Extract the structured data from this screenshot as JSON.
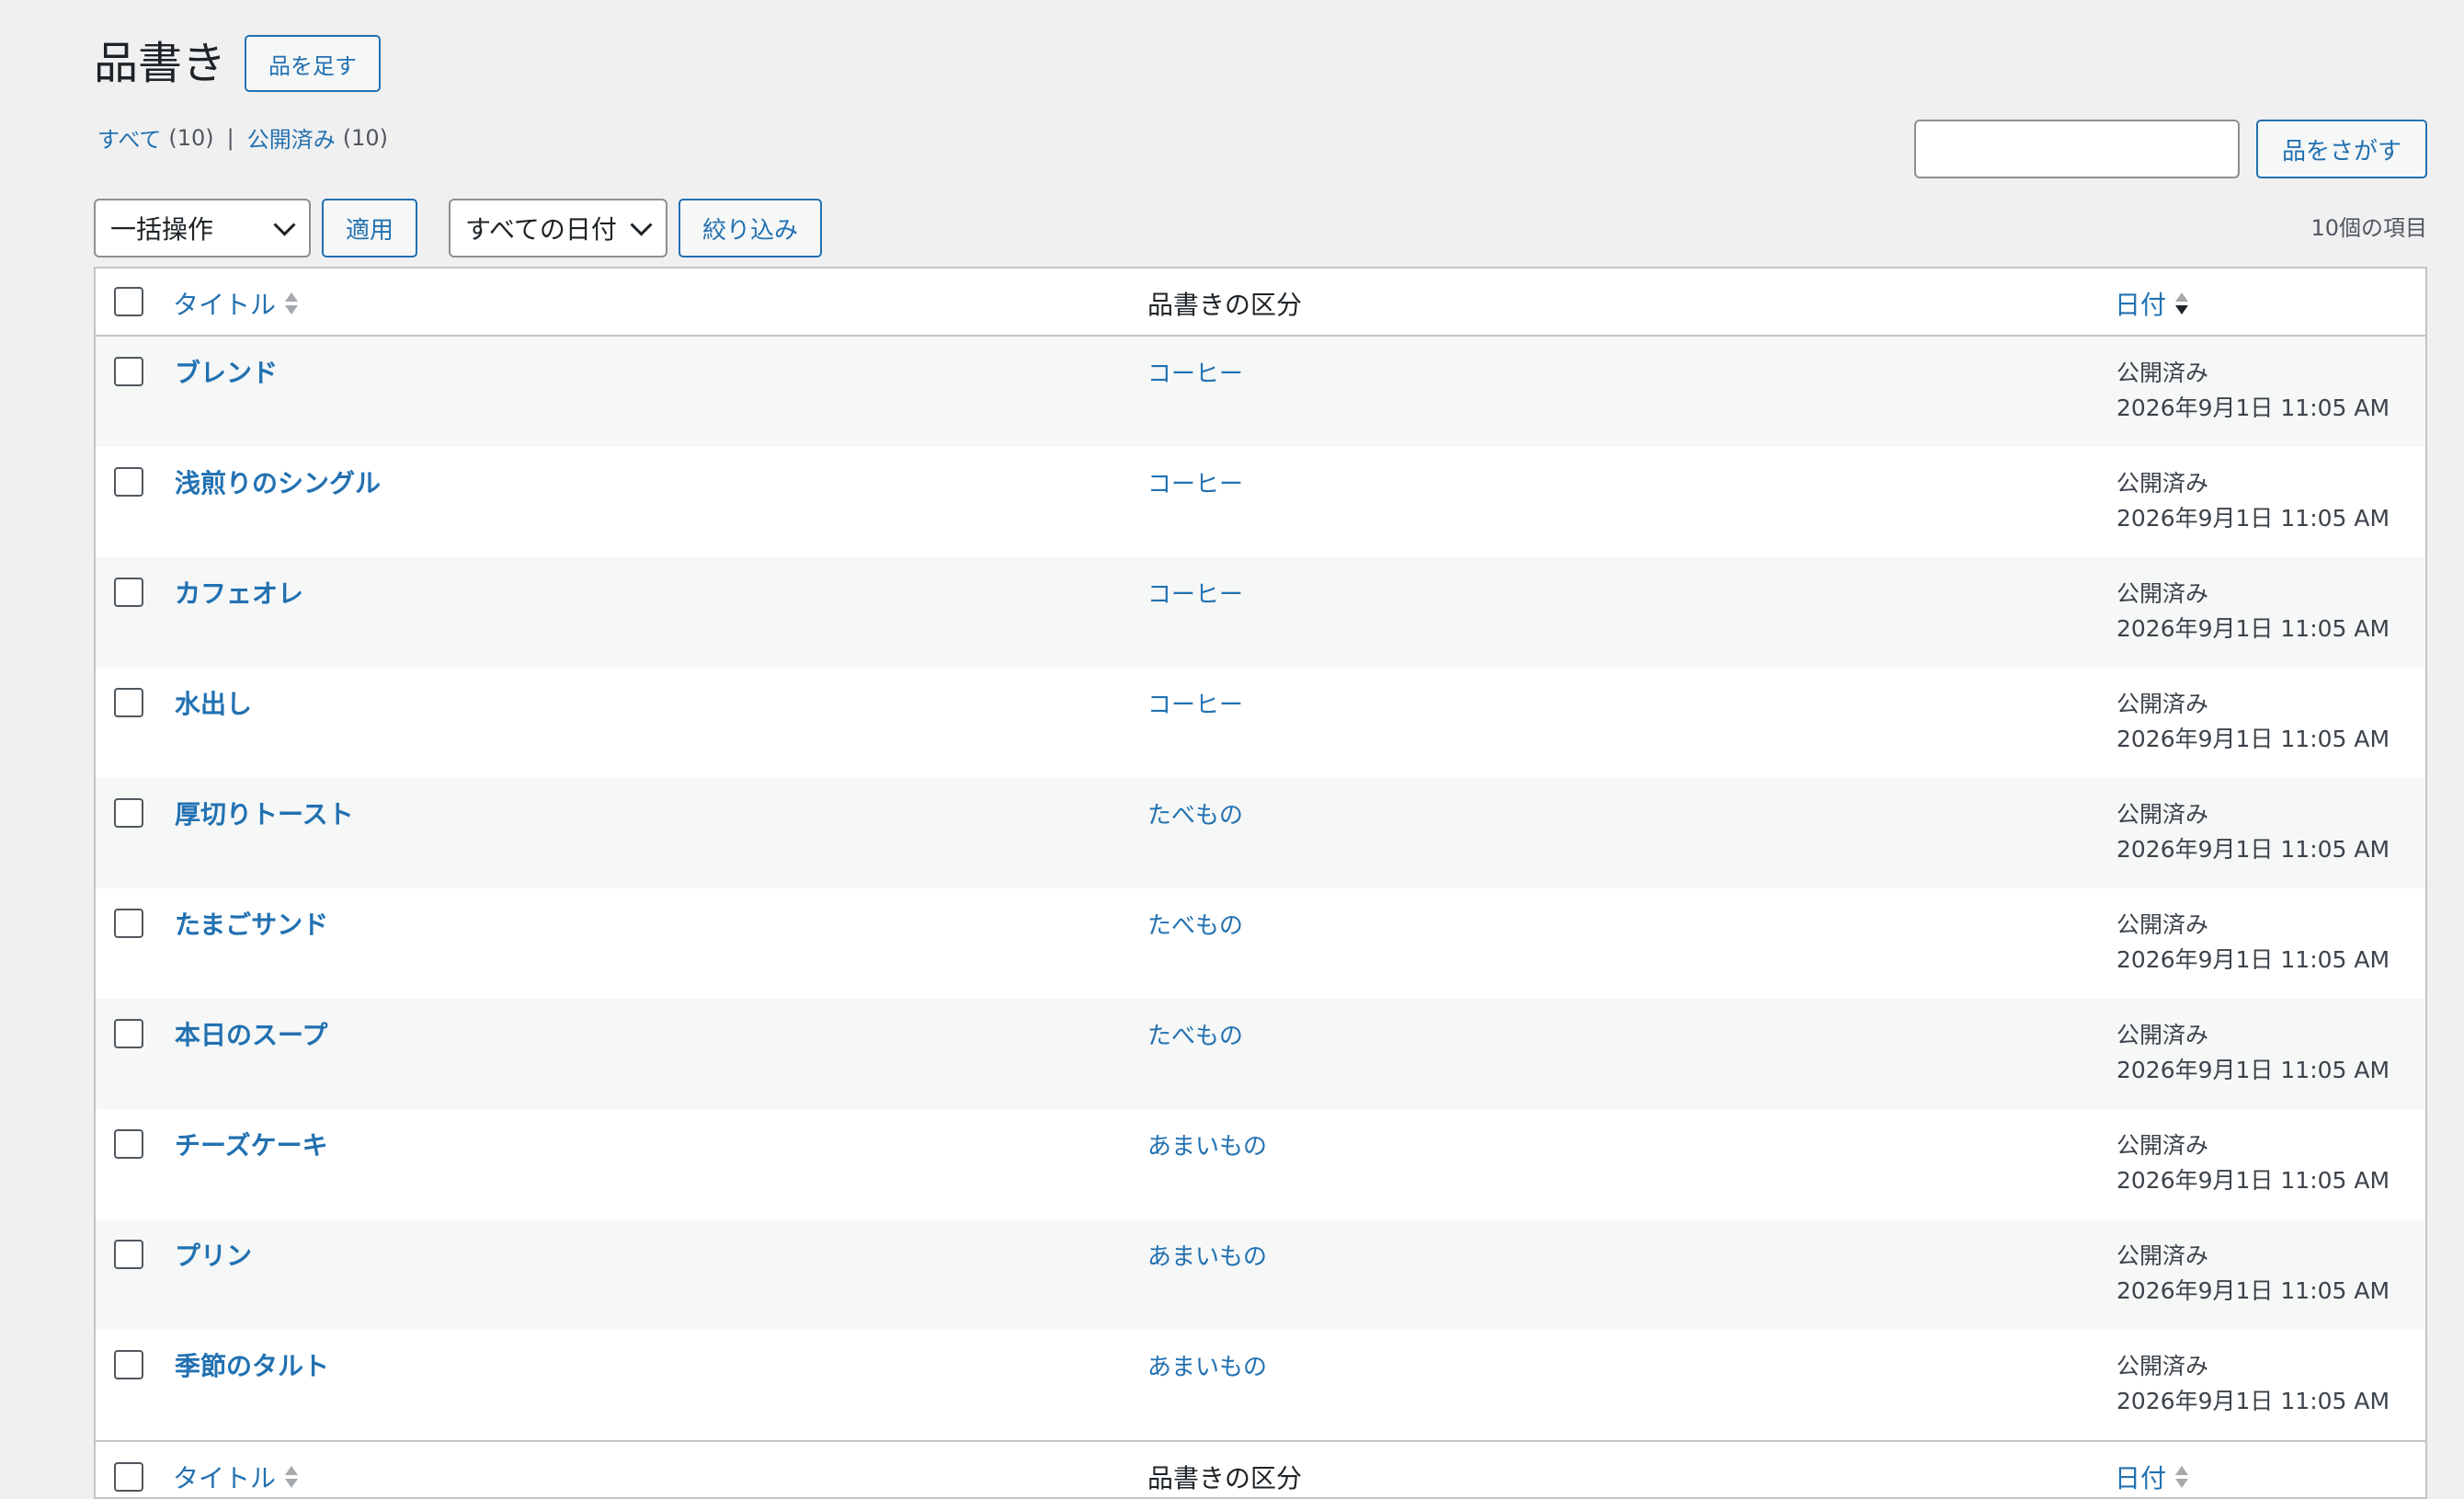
{
  "header": {
    "title": "品書き",
    "add_new_label": "品を足す"
  },
  "views": {
    "all_label": "すべて",
    "all_count": "(10)",
    "separator": "|",
    "published_label": "公開済み",
    "published_count": "(10)"
  },
  "search": {
    "placeholder": "",
    "button_label": "品をさがす"
  },
  "tablenav": {
    "bulk_action_selected": "一括操作",
    "apply_label": "適用",
    "date_filter_selected": "すべての日付",
    "filter_label": "絞り込み",
    "item_count": "10個の項目"
  },
  "table": {
    "columns": {
      "title": "タイトル",
      "category": "品書きの区分",
      "date": "日付"
    },
    "sort": {
      "column": "date",
      "direction": "desc"
    },
    "rows": [
      {
        "title": "ブレンド",
        "category": "コーヒー",
        "status": "公開済み",
        "datetime": "2026年9月1日 11:05 AM"
      },
      {
        "title": "浅煎りのシングル",
        "category": "コーヒー",
        "status": "公開済み",
        "datetime": "2026年9月1日 11:05 AM"
      },
      {
        "title": "カフェオレ",
        "category": "コーヒー",
        "status": "公開済み",
        "datetime": "2026年9月1日 11:05 AM"
      },
      {
        "title": "水出し",
        "category": "コーヒー",
        "status": "公開済み",
        "datetime": "2026年9月1日 11:05 AM"
      },
      {
        "title": "厚切りトースト",
        "category": "たべもの",
        "status": "公開済み",
        "datetime": "2026年9月1日 11:05 AM"
      },
      {
        "title": "たまごサンド",
        "category": "たべもの",
        "status": "公開済み",
        "datetime": "2026年9月1日 11:05 AM"
      },
      {
        "title": "本日のスープ",
        "category": "たべもの",
        "status": "公開済み",
        "datetime": "2026年9月1日 11:05 AM"
      },
      {
        "title": "チーズケーキ",
        "category": "あまいもの",
        "status": "公開済み",
        "datetime": "2026年9月1日 11:05 AM"
      },
      {
        "title": "プリン",
        "category": "あまいもの",
        "status": "公開済み",
        "datetime": "2026年9月1日 11:05 AM"
      },
      {
        "title": "季節のタルト",
        "category": "あまいもの",
        "status": "公開済み",
        "datetime": "2026年9月1日 11:05 AM"
      }
    ]
  },
  "colors": {
    "link": "#2271b1",
    "background": "#f0f0f1",
    "alt_row": "#f6f7f7",
    "border": "#c3c4c7"
  }
}
